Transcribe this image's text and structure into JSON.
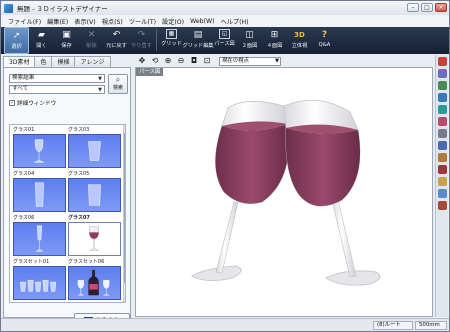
{
  "window": {
    "title": "無題 - ３Ｄイラストデザイナー",
    "minimize": "–",
    "maximize": "□",
    "close": "×"
  },
  "menu": [
    "ファイル(F)",
    "編集(E)",
    "表示(V)",
    "視点(S)",
    "ツール(T)",
    "設定(O)",
    "Web(W)",
    "ヘルプ(H)"
  ],
  "toolbar": {
    "select": "選択",
    "open": "開く",
    "save": "保存",
    "delete": "削除",
    "undo": "元に戻す",
    "redo": "やり直す",
    "grid": "グリッド",
    "grid_edit": "グリッド編集",
    "perspective": "パース図",
    "two_view": "２面図",
    "four_view": "４面図",
    "three_d_label": "3D",
    "solid": "立体視",
    "qa": "Q&A"
  },
  "left_panel": {
    "tabs": [
      "3D素材",
      "色",
      "模様",
      "アレンジ"
    ],
    "active_tab": "3D素材",
    "search_results": "検索結果",
    "filter": "すべて",
    "search_button": "検索",
    "detail_window": "詳細ウィンドウ",
    "detail_checked": true,
    "thumbnails": [
      {
        "name": "グラス01",
        "kind": "wine"
      },
      {
        "name": "グラス03",
        "kind": "tumbler"
      },
      {
        "name": "グラス04",
        "kind": "tall"
      },
      {
        "name": "グラス05",
        "kind": "tumbler"
      },
      {
        "name": "グラス06",
        "kind": "flute"
      },
      {
        "name": "グラス07",
        "kind": "redwine",
        "selected": true
      },
      {
        "name": "グラスセット01",
        "kind": "set"
      },
      {
        "name": "グラスセット06",
        "kind": "bottle"
      }
    ],
    "export_button": "画像出力"
  },
  "viewport": {
    "tab_label": "パース図",
    "view_select": "現在の視点",
    "accent": "#8a3a5d"
  },
  "status": {
    "root": "(8)ルート",
    "size": "500mm"
  }
}
